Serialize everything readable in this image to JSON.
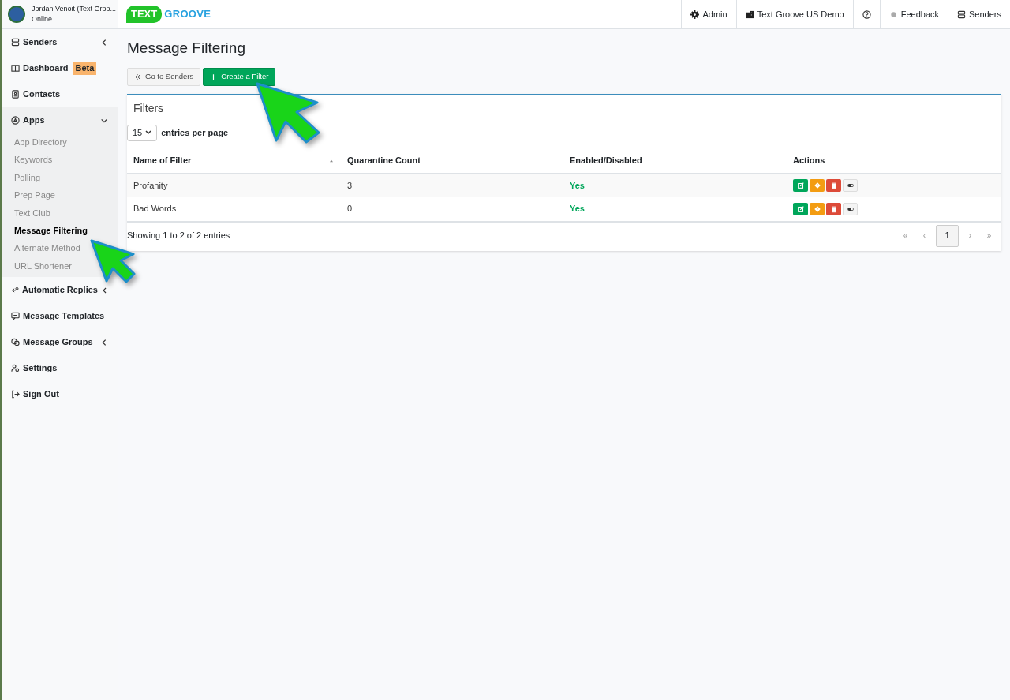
{
  "user": {
    "name": "Jordan Venoit (Text Groo...",
    "status": "Online"
  },
  "logo": {
    "first": "TEXT",
    "second": "GROOVE"
  },
  "top_nav": [
    {
      "kind": "admin",
      "label": "Admin"
    },
    {
      "kind": "account",
      "label": "Text Groove US Demo"
    },
    {
      "kind": "help"
    },
    {
      "kind": "feedback",
      "label": "Feedback"
    },
    {
      "kind": "senders",
      "label": "Senders"
    }
  ],
  "sidebar": {
    "items": [
      {
        "kind": "senders",
        "label": "Senders",
        "expanded": false
      },
      {
        "kind": "dashboard",
        "label": "Dashboard",
        "badge": "Beta"
      },
      {
        "kind": "contacts",
        "label": "Contacts"
      },
      {
        "kind": "apps",
        "label": "Apps",
        "expanded": true,
        "children": [
          {
            "label": "App Directory",
            "selected": false
          },
          {
            "label": "Keywords",
            "selected": false
          },
          {
            "label": "Polling",
            "selected": false
          },
          {
            "label": "Prep Page",
            "selected": false
          },
          {
            "label": "Text Club",
            "selected": false
          },
          {
            "label": "Message Filtering",
            "selected": true
          },
          {
            "label": "Alternate Method",
            "selected": false
          },
          {
            "label": "URL Shortener",
            "selected": false
          }
        ]
      },
      {
        "kind": "replies",
        "label": "Automatic Replies",
        "expanded": false
      },
      {
        "kind": "templates",
        "label": "Message Templates"
      },
      {
        "kind": "groups",
        "label": "Message Groups",
        "expanded": false
      },
      {
        "kind": "settings",
        "label": "Settings"
      },
      {
        "kind": "signout",
        "label": "Sign Out"
      }
    ]
  },
  "page_title": "Message Filtering",
  "buttons": [
    {
      "kind": "back",
      "label": "Go to Senders"
    },
    {
      "kind": "create",
      "label": "Create a Filter"
    }
  ],
  "panel": {
    "title": "Filters",
    "page_size": "15",
    "page_size_label": "entries per page",
    "columns": [
      {
        "label": "Name of Filter",
        "sorted": true
      },
      {
        "label": "Quarantine Count",
        "sorted": false
      },
      {
        "label": "Enabled/Disabled",
        "sorted": false
      },
      {
        "label": "Actions",
        "sorted": false
      }
    ],
    "rows": [
      {
        "name": "Profanity",
        "count": "3",
        "enabled": "Yes"
      },
      {
        "name": "Bad Words",
        "count": "0",
        "enabled": "Yes"
      }
    ],
    "info": "Showing 1 to 2 of 2 entries",
    "pagination": [
      {
        "label": "«",
        "selected": false
      },
      {
        "label": "‹",
        "selected": false
      },
      {
        "label": "1",
        "selected": true
      },
      {
        "label": "›",
        "selected": false
      },
      {
        "label": "»",
        "selected": false
      }
    ]
  }
}
